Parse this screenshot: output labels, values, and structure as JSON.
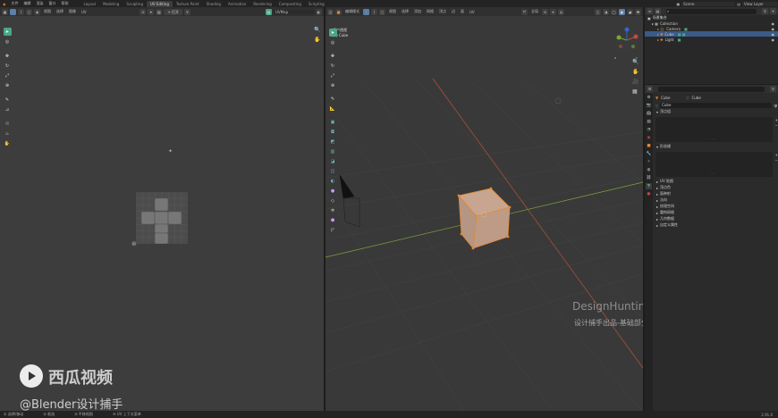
{
  "topbar": {
    "menus": [
      "文件",
      "编辑",
      "渲染",
      "窗口",
      "帮助"
    ],
    "workspace_tabs": [
      "Layout",
      "Modeling",
      "Sculpting",
      "UV Editing",
      "Texture Paint",
      "Shading",
      "Animation",
      "Rendering",
      "Compositing",
      "Scripting"
    ],
    "active_tab": "UV Editing",
    "scene_label": "Scene",
    "view_layer_label": "View Layer"
  },
  "uv_editor": {
    "header_menus": [
      "视图",
      "选择",
      "图像",
      "UV"
    ],
    "new_label": "+ 打开",
    "uvmap_label": "UVMap"
  },
  "viewport": {
    "mode_label": "编辑模式",
    "header_menus": [
      "视图",
      "选择",
      "添加",
      "网格",
      "顶点",
      "边",
      "面",
      "UV"
    ],
    "transform_label": "全局",
    "view_name": "用户透视",
    "object_name": "(1) Cube",
    "corner_left": "X",
    "corner_right": "Y"
  },
  "outliner": {
    "search_placeholder": "",
    "root": "场景集合",
    "items": [
      {
        "name": "Collection",
        "icon": "collection-icon"
      },
      {
        "name": "Camera",
        "icon": "camera-icon"
      },
      {
        "name": "Cube",
        "icon": "mesh-icon"
      },
      {
        "name": "Light",
        "icon": "light-icon"
      }
    ]
  },
  "properties": {
    "object_label": "Cube",
    "data_label": "Cube",
    "mesh_name": "Cube",
    "sections_top": [
      "顶点组",
      "形态键"
    ],
    "sections": [
      "UV 贴图",
      "顶点色",
      "面映射",
      "法向",
      "纹理空间",
      "重构网格",
      "几何数据",
      "自定义属性"
    ]
  },
  "statusbar": {
    "items": [
      "① 选择/移动",
      "② 框选",
      "③ 平移视图",
      "④ UV 上下文菜单"
    ],
    "version": "2.91.0"
  },
  "watermark": {
    "brand": "DesignHunting",
    "subtitle": "设计捕手出品-基础部分",
    "app": "西瓜视频",
    "handle": "@Blender设计捕手"
  },
  "colors": {
    "accent": "#4aa58a",
    "selection": "#5b7fa6",
    "orange": "#e8882a"
  }
}
